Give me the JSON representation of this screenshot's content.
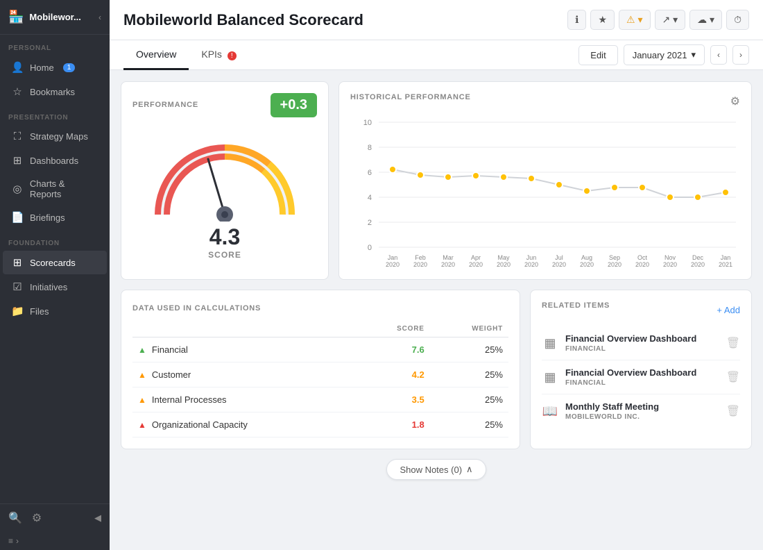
{
  "sidebar": {
    "logo_text": "Mobilewor...",
    "sections": [
      {
        "label": "PERSONAL",
        "items": [
          {
            "id": "home",
            "icon": "👤",
            "label": "Home",
            "badge": "1",
            "active": false
          },
          {
            "id": "bookmarks",
            "icon": "☆",
            "label": "Bookmarks",
            "badge": null,
            "active": false
          }
        ]
      },
      {
        "label": "PRESENTATION",
        "items": [
          {
            "id": "strategy-maps",
            "icon": "⛶",
            "label": "Strategy Maps",
            "badge": null,
            "active": false
          },
          {
            "id": "dashboards",
            "icon": "⊞",
            "label": "Dashboards",
            "badge": null,
            "active": false
          },
          {
            "id": "charts-reports",
            "icon": "◎",
            "label": "Charts & Reports",
            "badge": null,
            "active": false
          },
          {
            "id": "briefings",
            "icon": "📄",
            "label": "Briefings",
            "badge": null,
            "active": false
          }
        ]
      },
      {
        "label": "FOUNDATION",
        "items": [
          {
            "id": "scorecards",
            "icon": "⊞",
            "label": "Scorecards",
            "badge": null,
            "active": true
          },
          {
            "id": "initiatives",
            "icon": "☑",
            "label": "Initiatives",
            "badge": null,
            "active": false
          },
          {
            "id": "files",
            "icon": "📁",
            "label": "Files",
            "badge": null,
            "active": false
          }
        ]
      }
    ]
  },
  "header": {
    "title": "Mobileworld Balanced Scorecard",
    "buttons": [
      "ℹ",
      "★",
      "⚠",
      "↗",
      "☁",
      "⏱"
    ]
  },
  "tabs": {
    "items": [
      {
        "label": "Overview",
        "active": true,
        "badge": null
      },
      {
        "label": "KPIs",
        "active": false,
        "badge": "!"
      }
    ],
    "edit_label": "Edit",
    "date_label": "January 2021"
  },
  "performance": {
    "title": "PERFORMANCE",
    "badge": "+0.3",
    "score": "4.3",
    "score_label": "SCORE"
  },
  "historical": {
    "title": "HISTORICAL PERFORMANCE",
    "y_labels": [
      "10",
      "8",
      "6",
      "4",
      "2",
      "0"
    ],
    "x_labels": [
      "Jan\n2020",
      "Feb\n2020",
      "Mar\n2020",
      "Apr\n2020",
      "May\n2020",
      "Jun\n2020",
      "Jul\n2020",
      "Aug\n2020",
      "Sep\n2020",
      "Oct\n2020",
      "Nov\n2020",
      "Dec\n2020",
      "Jan\n2021"
    ],
    "data_points": [
      6.2,
      5.8,
      5.6,
      5.7,
      5.6,
      5.5,
      5.0,
      4.5,
      4.8,
      4.8,
      4.0,
      4.0,
      4.4
    ]
  },
  "data_table": {
    "title": "DATA USED IN CALCULATIONS",
    "col_score": "SCORE",
    "col_weight": "WEIGHT",
    "rows": [
      {
        "icon": "tri-green",
        "label": "Financial",
        "score": "7.6",
        "score_class": "green",
        "weight": "25%"
      },
      {
        "icon": "tri-orange",
        "label": "Customer",
        "score": "4.2",
        "score_class": "orange",
        "weight": "25%"
      },
      {
        "icon": "tri-orange",
        "label": "Internal Processes",
        "score": "3.5",
        "score_class": "orange",
        "weight": "25%"
      },
      {
        "icon": "tri-red",
        "label": "Organizational Capacity",
        "score": "1.8",
        "score_class": "red",
        "weight": "25%"
      }
    ]
  },
  "related_items": {
    "title": "RELATED ITEMS",
    "add_label": "+ Add",
    "items": [
      {
        "icon": "▦",
        "name": "Financial Overview Dashboard",
        "sub": "FINANCIAL",
        "type": "dashboard"
      },
      {
        "icon": "▦",
        "name": "Financial Overview Dashboard",
        "sub": "FINANCIAL",
        "type": "dashboard"
      },
      {
        "icon": "📖",
        "name": "Monthly Staff Meeting",
        "sub": "MOBILEWORLD INC.",
        "type": "meeting"
      }
    ]
  },
  "show_notes": {
    "label": "Show Notes (0)",
    "icon": "∧"
  }
}
